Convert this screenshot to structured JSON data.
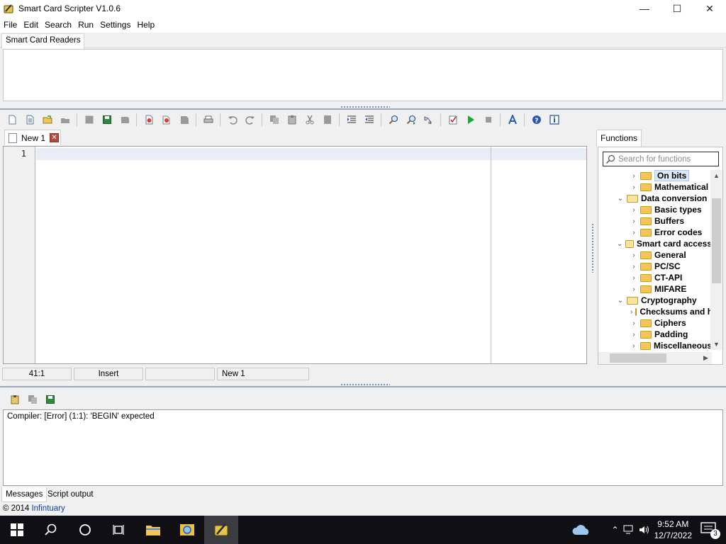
{
  "window": {
    "title": "Smart Card Scripter V1.0.6",
    "controls": {
      "minimize": "—",
      "maximize": "☐",
      "close": "✕"
    }
  },
  "menu": [
    "File",
    "Edit",
    "Search",
    "Run",
    "Settings",
    "Help"
  ],
  "readers": {
    "tab_label": "Smart Card Readers"
  },
  "toolbar": {
    "icons": [
      "new-file-icon",
      "new-template-icon",
      "open-icon",
      "open-recent-icon",
      "save-icon-disabled",
      "save-icon",
      "save-all-icon",
      "close-icon-disabled",
      "close-all-icon",
      "close-others-icon",
      "print-icon",
      "undo-icon",
      "redo-icon",
      "copy-icon",
      "paste-icon",
      "cut-icon",
      "delete-icon",
      "indent-icon",
      "unindent-icon",
      "find-icon",
      "find-next-icon",
      "replace-icon",
      "compile-icon",
      "run-icon",
      "stop-icon",
      "font-icon",
      "help-icon",
      "about-icon"
    ]
  },
  "editor": {
    "tab_label": "New 1",
    "close_glyph": "✕",
    "line_numbers": [
      "1"
    ]
  },
  "functions": {
    "tab_label": "Functions",
    "search_placeholder": "Search for functions",
    "tree": [
      {
        "label": "On bits",
        "level": 2,
        "expanded": false,
        "highlighted": true
      },
      {
        "label": "Mathematical",
        "level": 2,
        "expanded": false
      },
      {
        "label": "Data conversion",
        "level": 1,
        "expanded": true
      },
      {
        "label": "Basic types",
        "level": 2,
        "expanded": false
      },
      {
        "label": "Buffers",
        "level": 2,
        "expanded": false
      },
      {
        "label": "Error codes",
        "level": 2,
        "expanded": false
      },
      {
        "label": "Smart card access",
        "level": 1,
        "expanded": true
      },
      {
        "label": "General",
        "level": 2,
        "expanded": false
      },
      {
        "label": "PC/SC",
        "level": 2,
        "expanded": false
      },
      {
        "label": "CT-API",
        "level": 2,
        "expanded": false
      },
      {
        "label": "MIFARE",
        "level": 2,
        "expanded": false
      },
      {
        "label": "Cryptography",
        "level": 1,
        "expanded": true
      },
      {
        "label": "Checksums and hashes",
        "level": 2,
        "expanded": false
      },
      {
        "label": "Ciphers",
        "level": 2,
        "expanded": false
      },
      {
        "label": "Padding",
        "level": 2,
        "expanded": false
      },
      {
        "label": "Miscellaneous",
        "level": 2,
        "expanded": false
      }
    ]
  },
  "status": {
    "position": "41:1",
    "mode": "Insert",
    "extra": "",
    "file": "New 1"
  },
  "messages": {
    "lines": [
      "Compiler: [Error] (1:1): 'BEGIN' expected"
    ],
    "tabs": [
      "Messages",
      "Script output"
    ]
  },
  "footer": {
    "copyright_prefix": "© 2014 ",
    "company": "Infintuary"
  },
  "taskbar": {
    "time": "9:52 AM",
    "date": "12/7/2022",
    "notification_count": "3"
  }
}
